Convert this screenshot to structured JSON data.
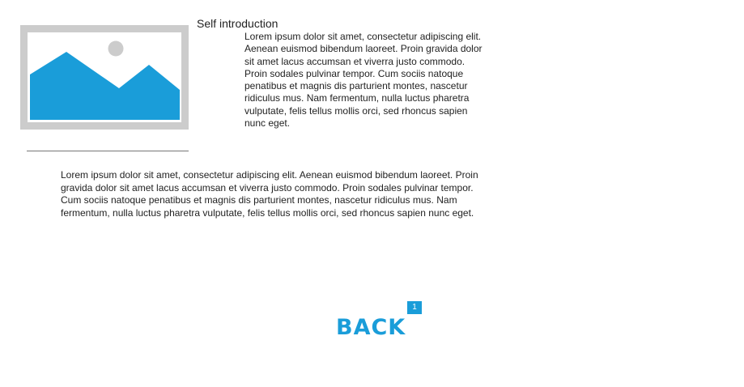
{
  "colors": {
    "accent": "#1a9dd9",
    "frame": "#cccccc",
    "sun": "#cccccc"
  },
  "intro": {
    "heading": "Self introduction",
    "image_icon": "image-placeholder-icon",
    "paragraph": "Lorem ipsum dolor sit amet, consectetur adipiscing elit. Aenean euismod bibendum laoreet. Proin gravida dolor sit amet lacus accumsan et viverra justo commodo. Proin sodales pulvinar tempor. Cum sociis natoque penatibus et magnis dis parturient montes, nascetur ridiculus mus. Nam fermentum, nulla luctus pharetra vulputate, felis tellus mollis orci, sed rhoncus sapien nunc eget."
  },
  "body": {
    "paragraph": "Lorem ipsum dolor sit amet, consectetur adipiscing elit. Aenean euismod bibendum laoreet. Proin gravida dolor sit amet lacus accumsan et viverra justo commodo. Proin sodales pulvinar tempor. Cum sociis natoque penatibus et magnis dis parturient montes, nascetur ridiculus mus. Nam fermentum, nulla luctus pharetra vulputate, felis tellus mollis orci, sed rhoncus sapien nunc eget."
  },
  "back_button": {
    "label": "BACK",
    "badge": "1"
  }
}
